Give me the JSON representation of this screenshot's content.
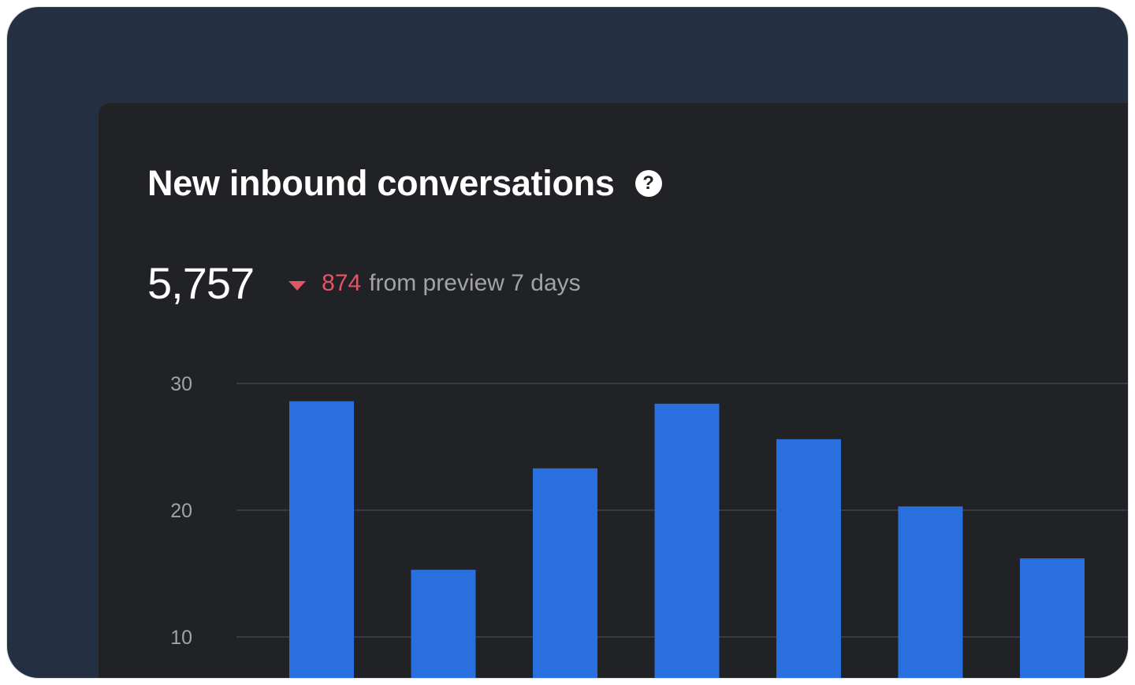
{
  "card": {
    "title": "New inbound conversations",
    "help_icon": "?",
    "metric_value": "5,757",
    "delta_value": "874",
    "delta_text": "from preview 7 days"
  },
  "colors": {
    "background": "#243041",
    "card": "#212225",
    "bar": "#2a6fe0",
    "negative": "#e25468",
    "muted_text": "#a1a3a8",
    "gridline": "#3a3b40"
  },
  "chart_data": {
    "type": "bar",
    "categories": [
      "",
      "",
      "",
      "",
      "",
      "",
      ""
    ],
    "series": [
      {
        "values": [
          28.6,
          15.3,
          23.3,
          28.4,
          25.6,
          20.3,
          16.2
        ]
      }
    ],
    "ylim": [
      8,
      30
    ],
    "yticks": [
      30,
      20,
      10
    ],
    "grid": true,
    "title": "",
    "xlabel": "",
    "ylabel": ""
  }
}
